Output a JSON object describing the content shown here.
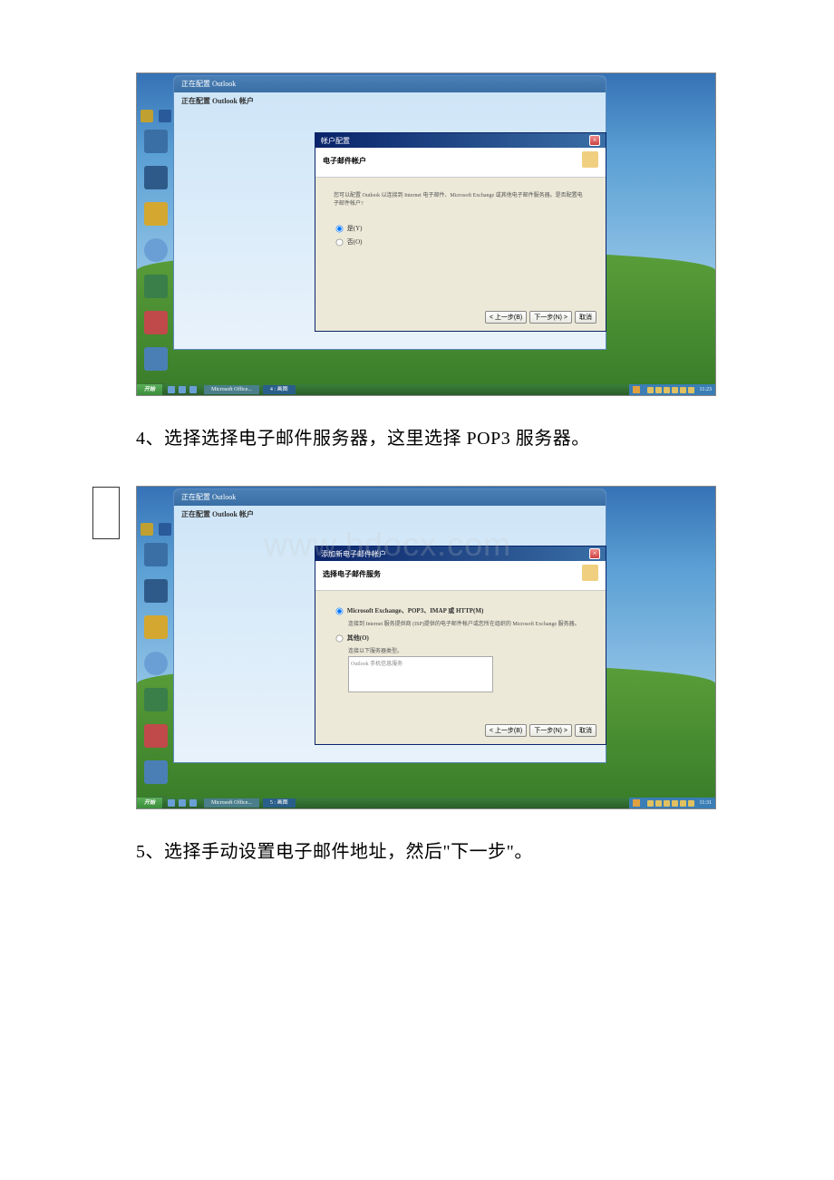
{
  "step4": {
    "number": "4、",
    "text": "选择选择电子邮件服务器，这里选择 POP3 服务器。"
  },
  "step5": {
    "number": "5、",
    "text": "选择手动设置电子邮件地址，然后\"下一步\"。"
  },
  "screenshot1": {
    "outlook_title": "正在配置 Outlook",
    "outlook_sidebar": "正在配置 Outlook 帐户",
    "dialog": {
      "title": "帐户配置",
      "header": "电子邮件帐户",
      "hint": "您可以配置 Outlook 以连接到 Internet 电子邮件、Microsoft Exchange 或其他电子邮件服务器。是否配置电子邮件帐户?",
      "radio_yes": "是(Y)",
      "radio_no": "否(O)",
      "btn_back": "< 上一步(B)",
      "btn_next": "下一步(N) >",
      "btn_cancel": "取消"
    },
    "taskbar": {
      "start": "开始",
      "task1": "Microsoft Office...",
      "task2": "4 : 画图",
      "time": "11:23"
    }
  },
  "screenshot2": {
    "outlook_title": "正在配置 Outlook",
    "outlook_sidebar": "正在配置 Outlook 帐户",
    "watermark": "www.bdocx.com",
    "dialog": {
      "title": "添加新电子邮件帐户",
      "header": "选择电子邮件服务",
      "radio_exchange": "Microsoft Exchange、POP3、IMAP 或 HTTP(M)",
      "exchange_desc": "连接到 Internet 服务提供商 (ISP)提供的电子邮件帐户或您所在组织的 Microsoft Exchange 服务器。",
      "radio_other": "其他(O)",
      "other_desc": "连接以下服务器类型。",
      "server_item": "Outlook 手机信息服务",
      "btn_back": "< 上一步(B)",
      "btn_next": "下一步(N) >",
      "btn_cancel": "取消"
    },
    "taskbar": {
      "start": "开始",
      "task1": "Microsoft Office...",
      "task2": "5 : 画图",
      "time": "11:31"
    }
  }
}
